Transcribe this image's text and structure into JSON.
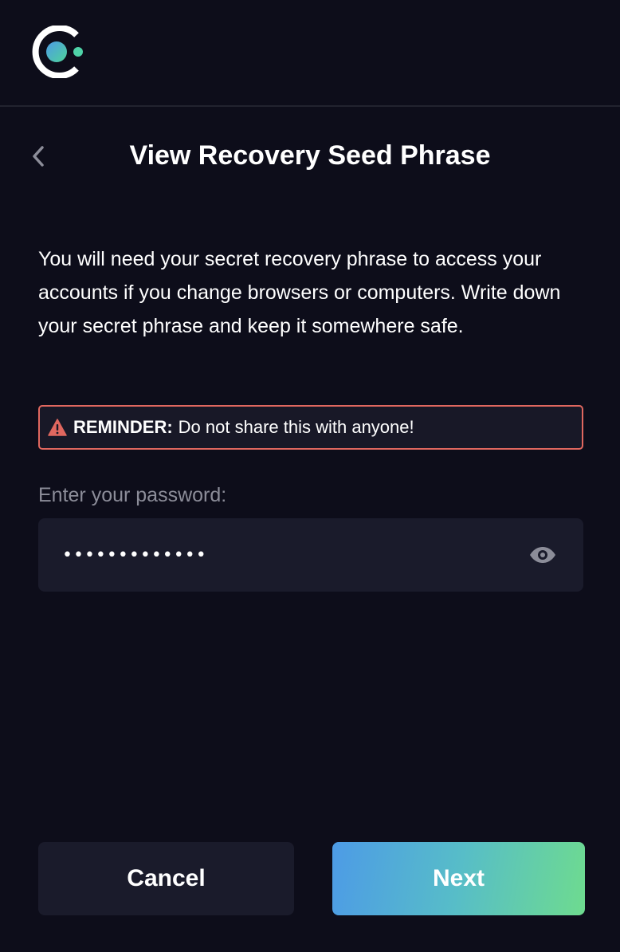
{
  "header": {
    "logo_icon": "celo-logo-icon"
  },
  "page": {
    "back_icon": "chevron-left-icon",
    "title": "View Recovery Seed Phrase",
    "description": "You will need your secret recovery phrase to access your accounts if you change browsers or computers. Write down your secret phrase and keep it somewhere safe."
  },
  "reminder": {
    "icon": "warning-triangle-icon",
    "label": "REMINDER:",
    "text": "Do not share this with anyone!",
    "border_color": "#e0675f"
  },
  "password": {
    "label": "Enter your password:",
    "value": "•••••••••••••",
    "toggle_icon": "eye-icon"
  },
  "actions": {
    "cancel_label": "Cancel",
    "next_label": "Next"
  },
  "colors": {
    "background": "#0d0d1a",
    "field": "#1a1b2b",
    "gradient_start": "#4d9be6",
    "gradient_end": "#6edb8f"
  }
}
